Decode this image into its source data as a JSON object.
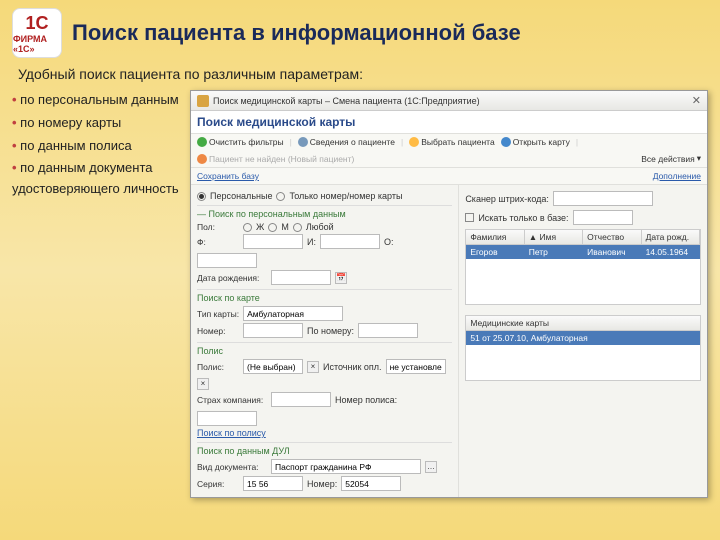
{
  "slide": {
    "title": "Поиск пациента в информационной базе",
    "subtitle": "Удобный поиск пациента по различным параметрам:",
    "bullets": [
      "по персональным данным",
      "по номеру карты",
      "по данным полиса",
      "по данным документа удостоверяющего личность"
    ]
  },
  "app": {
    "titlebar": "Поиск медицинской карты – Смена пациента (1С:Предприятие)",
    "heading": "Поиск медицинской карты",
    "toolbar": {
      "clear": "Очистить фильтры",
      "info": "Сведения о пациенте",
      "select": "Выбрать пациента",
      "open": "Открыть карту",
      "notfound": "Пациент не найден (Новый пациент)",
      "allactions": "Все действия"
    },
    "link_save": "Сохранить базу",
    "tabs": {
      "personal": "Персональные",
      "card": "Только номер/номер карты"
    },
    "scan_prompt": "Сканер штрих-кода:",
    "sex": {
      "label": "Пол:",
      "f": "Ж",
      "m": "М",
      "any": "Любой"
    },
    "fio": {
      "f": "Ф:",
      "i": "И:",
      "o": "О:"
    },
    "dob": {
      "label": "Дата рождения:"
    },
    "section_card": "Поиск по карте",
    "card": {
      "type_lbl": "Тип карты:",
      "type_val": "Амбулаторная",
      "num_lbl": "Номер:",
      "bynum": "По номеру:"
    },
    "section_policy": "Полис",
    "policy": {
      "lbl": "Полис:",
      "val": "(Не выбран)",
      "pay": "Источник опл.",
      "pay_val": "не установлен",
      "company": "Страх компания:",
      "num": "Номер полиса:"
    },
    "link_policy": "Поиск по полису",
    "section_dul": "Поиск по данным ДУЛ",
    "dul": {
      "kind_lbl": "Вид документа:",
      "kind_val": "Паспорт гражданина РФ",
      "series_lbl": "Серия:",
      "series_val": "15 56",
      "num_lbl": "Номер:",
      "num_val": "52054"
    },
    "results": {
      "only_db": "Искать только в базе:",
      "cols": {
        "fam": "Фамилия",
        "im": "Имя",
        "ot": "Отчество",
        "dob": "Дата рожд."
      },
      "row": {
        "fam": "Егоров",
        "im": "Петр",
        "ot": "Иванович",
        "dob": "14.05.1964"
      },
      "cards_title": "Медицинские карты",
      "card_row": "51 от 25.07.10, Амбулаторная"
    },
    "link_more": "Дополнение"
  }
}
